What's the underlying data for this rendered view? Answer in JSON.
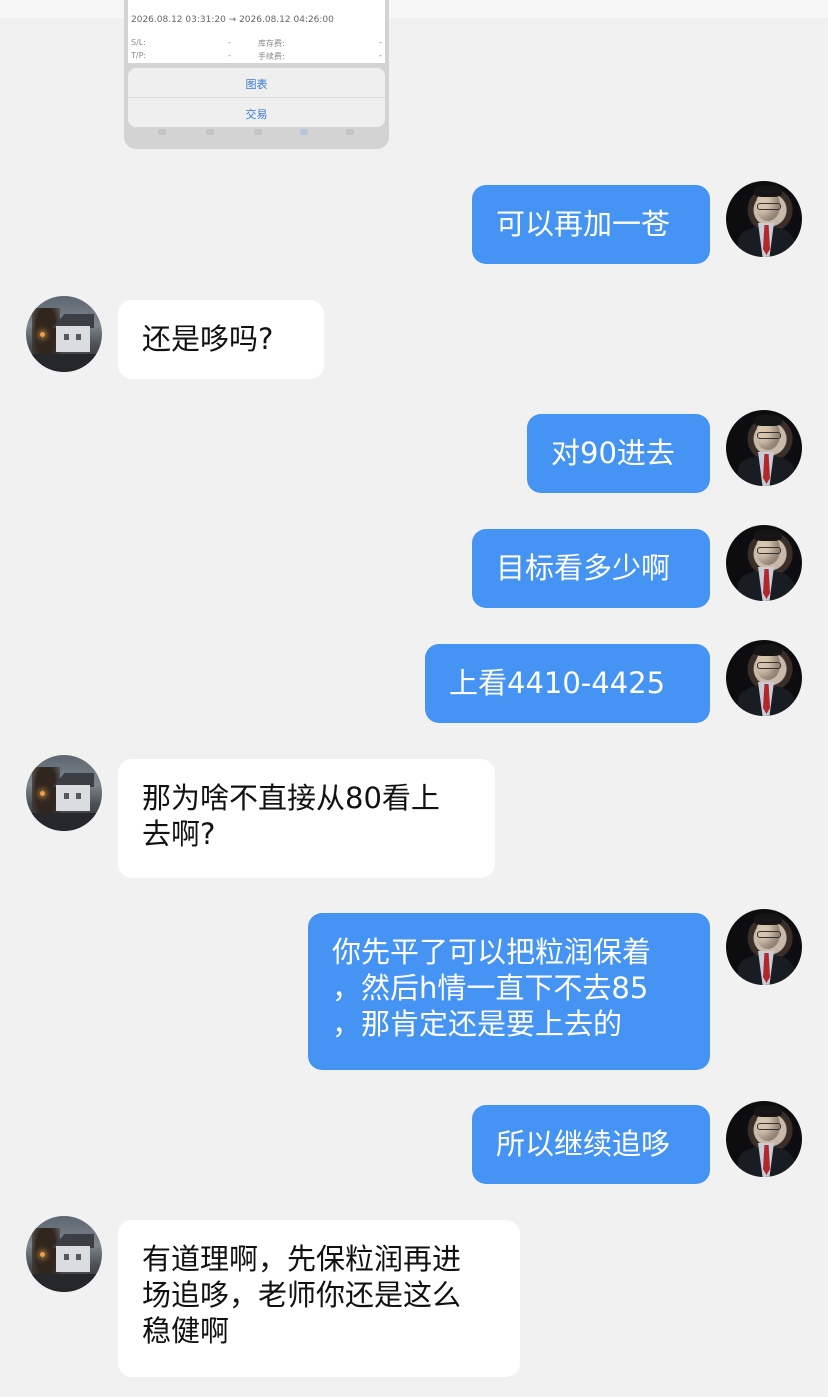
{
  "trade_card": {
    "time_range": "2026.08.12 03:31:20 → 2026.08.12 04:26:00",
    "rows": [
      {
        "label": "S/L:",
        "value": "-",
        "label2": "库存费:",
        "value2": "-"
      },
      {
        "label": "T/P:",
        "value": "-",
        "label2": "手续费:",
        "value2": "-"
      }
    ],
    "actions": [
      "图表",
      "交易"
    ]
  },
  "messages": [
    {
      "sender": "teacher",
      "direction": "outgoing",
      "text": "可以再加一苍"
    },
    {
      "sender": "user",
      "direction": "incoming",
      "text": "还是哆吗?"
    },
    {
      "sender": "teacher",
      "direction": "outgoing",
      "text": "对90进去"
    },
    {
      "sender": "teacher",
      "direction": "outgoing",
      "text": "目标看多少啊"
    },
    {
      "sender": "teacher",
      "direction": "outgoing",
      "text": "上看4410-4425"
    },
    {
      "sender": "user",
      "direction": "incoming",
      "text": "那为啥不直接从80看上\n去啊?"
    },
    {
      "sender": "teacher",
      "direction": "outgoing",
      "text": "你先平了可以把粒润保着\n，然后h情一直下不去85\n，那肯定还是要上去的"
    },
    {
      "sender": "teacher",
      "direction": "outgoing",
      "text": "所以继续追哆"
    },
    {
      "sender": "user",
      "direction": "incoming",
      "text": "有道理啊，先保粒润再进\n场追哆，老师你还是这么\n稳健啊"
    }
  ],
  "colors": {
    "background": "#f1f1f2",
    "outgoing_bubble": "#4593f2",
    "incoming_bubble": "#ffffff"
  }
}
